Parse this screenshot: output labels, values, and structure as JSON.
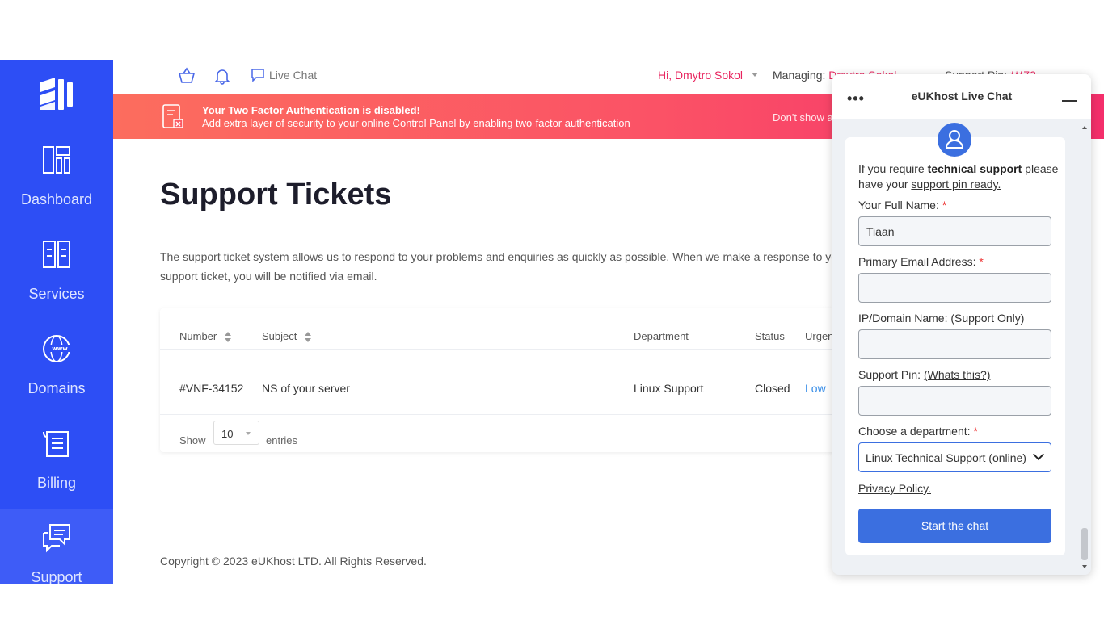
{
  "sidebar": {
    "items": [
      {
        "label": "Dashboard",
        "icon": "dashboard-icon"
      },
      {
        "label": "Services",
        "icon": "services-icon"
      },
      {
        "label": "Domains",
        "icon": "www-globe-icon"
      },
      {
        "label": "Billing",
        "icon": "billing-icon"
      },
      {
        "label": "Support",
        "icon": "chat-bubbles-icon"
      }
    ]
  },
  "topbar": {
    "live_chat": "Live Chat",
    "greeting": "Hi, Dmytro Sokol",
    "managing_label": "Managing:",
    "managing_name": "Dmytro Sokol",
    "support_pin_label": "Support Pin:",
    "support_pin_value": "***72"
  },
  "banner": {
    "title": "Your Two Factor Authentication is disabled!",
    "text": "Add extra layer of security to your online Control Panel by enabling two-factor authentication",
    "dont_show": "Don't show a"
  },
  "main": {
    "title": "Support Tickets",
    "description": "The support ticket system allows us to respond to your problems and enquiries as quickly as possible. When we make a response to your support ticket, you will be notified via email.",
    "table": {
      "headers": [
        "Number",
        "Subject",
        "Department",
        "Status",
        "Urgency"
      ],
      "rows": [
        [
          "#VNF-34152",
          "NS of your server",
          "Linux Support",
          "Closed",
          "Low"
        ]
      ]
    },
    "show_label": "Show",
    "entries_value": "10",
    "entries_label": "entries"
  },
  "footer": {
    "copyright": "Copyright © 2023 eUKhost LTD. All Rights Reserved."
  },
  "chat": {
    "title": "eUKhost Live Chat",
    "intro_pre": "If you require ",
    "intro_bold": "technical support",
    "intro_mid": " please have your ",
    "intro_link": "support pin ready.",
    "full_name_label": "Your Full Name:",
    "full_name_value": "Tiaan",
    "email_label": "Primary Email Address:",
    "email_value": "",
    "ip_label": "IP/Domain Name: (Support Only)",
    "ip_value": "",
    "pin_label": "Support Pin:",
    "pin_link": "(Whats this?)",
    "pin_value": "",
    "department_label": "Choose a department:",
    "department_value": "Linux Technical Support (online)",
    "required_mark": "*",
    "privacy": "Privacy Policy.",
    "start_button": "Start the chat"
  },
  "colors": {
    "sidebar": "#2d4ef5",
    "accent_pink": "#e8245e",
    "chat_blue": "#3b6fe0"
  }
}
